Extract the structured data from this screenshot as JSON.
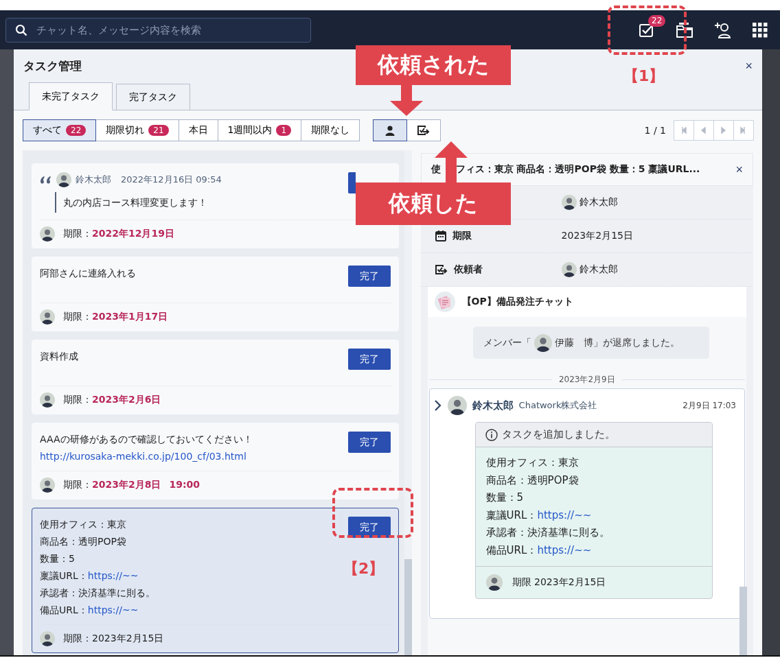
{
  "topbar": {
    "search": {
      "placeholder": "チャット名、メッセージ内容を検索"
    },
    "task_badge": "22"
  },
  "dialog": {
    "title": "タスク管理",
    "close": "×",
    "tabs": [
      {
        "label": "未完了タスク",
        "selected": true
      },
      {
        "label": "完了タスク",
        "selected": false
      }
    ],
    "filters": [
      {
        "label": "すべて",
        "count": "22",
        "selected": true
      },
      {
        "label": "期限切れ",
        "count": "21",
        "selected": false
      },
      {
        "label": "本日",
        "selected": false
      },
      {
        "label": "1週間以内",
        "count": "1",
        "selected": false
      },
      {
        "label": "期限なし",
        "selected": false
      }
    ],
    "direction_toggle": [
      {
        "kind": "assigned",
        "selected": true
      },
      {
        "kind": "requested",
        "selected": false
      }
    ],
    "pager": {
      "text": "1 / 1"
    },
    "tasks": [
      {
        "kind": "quote",
        "author": "鈴木太郎",
        "timestamp": "2022年12月16日 09:54",
        "lines": [
          {
            "text": "丸の内店コース料理変更します！"
          }
        ],
        "due_label": "期限：",
        "due": "2022年12月19日",
        "overdue": true,
        "selected": false
      },
      {
        "kind": "plain",
        "lines": [
          {
            "text": "阿部さんに連絡入れる"
          }
        ],
        "button": "完了",
        "due_label": "期限：",
        "due": "2023年1月17日",
        "overdue": true,
        "selected": false
      },
      {
        "kind": "plain",
        "lines": [
          {
            "text": "資料作成"
          }
        ],
        "button": "完了",
        "due_label": "期限：",
        "due": "2023年2月6日",
        "overdue": true,
        "selected": false
      },
      {
        "kind": "plain",
        "lines": [
          {
            "text": "AAAの研修があるので確認しておいてください！"
          },
          {
            "link": "http://kurosaka-mekki.co.jp/100_cf/03.html"
          }
        ],
        "button": "完了",
        "due_label": "期限：",
        "due": "2023年2月8日",
        "due_time": "19:00",
        "overdue": true,
        "selected": false
      },
      {
        "kind": "plain",
        "lines": [
          {
            "text": "使用オフィス：東京"
          },
          {
            "text": "商品名：透明POP袋"
          },
          {
            "text": "数量：5"
          },
          {
            "text": "稟議URL：",
            "link": "https://~~"
          },
          {
            "text": "承認者：決済基準に則る。"
          },
          {
            "text": "備品URL：",
            "link": "https://~~"
          }
        ],
        "button": "完了",
        "due_label": "期限：",
        "due": "2023年2月15日",
        "overdue": false,
        "selected": true
      }
    ],
    "detail": {
      "title_parts": [
        "使",
        "フィス：東京 商品名：透明POP袋 数量：5 稟議URL..."
      ],
      "close": "×",
      "rows": [
        {
          "kind": "assignee",
          "value": "鈴木太郎"
        },
        {
          "kind": "due",
          "label": "期限",
          "value": "2023年2月15日"
        },
        {
          "kind": "requester",
          "label": "依頼者",
          "value": "鈴木太郎"
        }
      ],
      "room": {
        "name": "【OP】備品発注チャット"
      },
      "system_message": {
        "before": "メンバー「",
        "member": "伊藤　博",
        "after": "」が退席しました。"
      },
      "date_divider": "2023年2月9日",
      "message": {
        "author": "鈴木太郎",
        "org": "Chatwork株式会社",
        "time": "2月9日 17:03",
        "task_header": "タスクを追加しました。",
        "lines": [
          {
            "text": "使用オフィス：東京"
          },
          {
            "text": "商品名：透明POP袋"
          },
          {
            "text": "数量：5"
          },
          {
            "text": "稟議URL：",
            "link": "https://~~"
          },
          {
            "text": "承認者：決済基準に則る。"
          },
          {
            "text": "備品URL：",
            "link": "https://~~"
          }
        ],
        "due": "期限 2023年2月15日"
      }
    }
  },
  "annotations": {
    "requested_to_me": {
      "text": "依頼された"
    },
    "requested_by_me": {
      "text": "依頼した"
    },
    "marker_1": "【1】",
    "marker_2": "【2】"
  }
}
